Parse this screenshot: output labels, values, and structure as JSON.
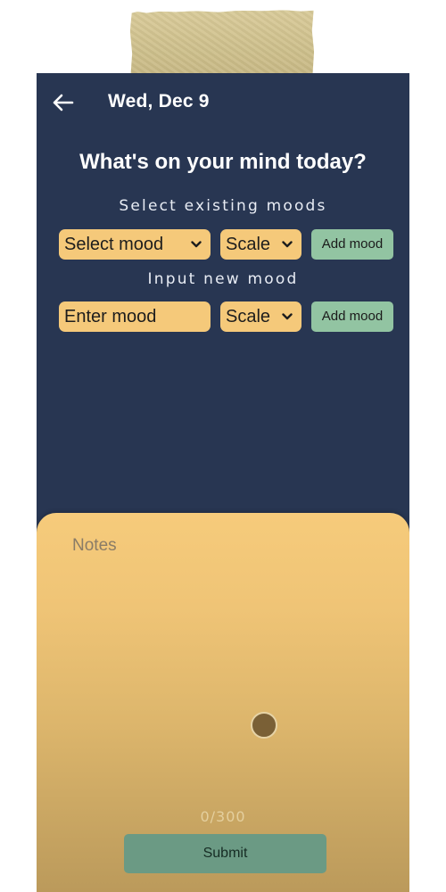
{
  "header": {
    "date": "Wed, Dec 9",
    "back_icon": "arrow-left-icon"
  },
  "main": {
    "headline": "What's on your mind today?",
    "existing_section_label": "Select existing moods",
    "new_section_label": "Input new mood",
    "existing_row": {
      "mood_select_value": "Select mood",
      "scale_select_value": "Scale",
      "add_button_label": "Add mood"
    },
    "new_row": {
      "mood_input_placeholder": "Enter mood",
      "scale_select_value": "Scale",
      "add_button_label": "Add mood"
    }
  },
  "notes": {
    "placeholder": "Notes",
    "counter": "0/300",
    "submit_label": "Submit"
  },
  "colors": {
    "screen_background": "#283652",
    "field_background": "#f5c97a",
    "add_button": "#92c4a2",
    "submit_button": "#6b9a84",
    "notes_sheet_top": "#f6cb7b",
    "notes_sheet_bottom": "#bb9a5b"
  }
}
